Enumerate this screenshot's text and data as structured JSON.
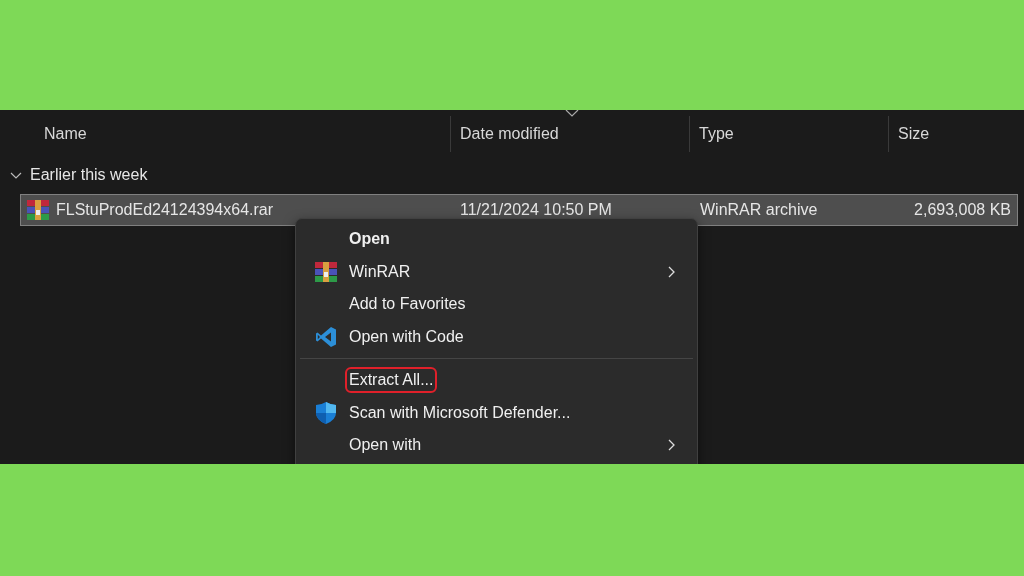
{
  "columns": [
    {
      "label": "Name",
      "sorted": false
    },
    {
      "label": "Date modified",
      "sorted": true
    },
    {
      "label": "Type",
      "sorted": false
    },
    {
      "label": "Size",
      "sorted": false
    }
  ],
  "group": {
    "label": "Earlier this week",
    "expanded": true
  },
  "files": [
    {
      "name": "FLStuProdEd24124394x64.rar",
      "date": "11/21/2024 10:50 PM",
      "type": "WinRAR archive",
      "size": "2,693,008 KB",
      "selected": true
    }
  ],
  "context_menu": [
    {
      "label": "Open",
      "kind": "plain",
      "default": true,
      "submenu": false,
      "highlighted": false
    },
    {
      "label": "WinRAR",
      "kind": "winrar",
      "default": false,
      "submenu": true,
      "highlighted": false
    },
    {
      "label": "Add to Favorites",
      "kind": "plain",
      "default": false,
      "submenu": false,
      "highlighted": false
    },
    {
      "label": "Open with Code",
      "kind": "code",
      "default": false,
      "submenu": false,
      "highlighted": false,
      "separator_after": true
    },
    {
      "label": "Extract All...",
      "kind": "plain",
      "default": false,
      "submenu": false,
      "highlighted": true
    },
    {
      "label": "Scan with Microsoft Defender...",
      "kind": "shield",
      "default": false,
      "submenu": false,
      "highlighted": false
    },
    {
      "label": "Open with",
      "kind": "plain",
      "default": false,
      "submenu": true,
      "highlighted": false
    }
  ]
}
